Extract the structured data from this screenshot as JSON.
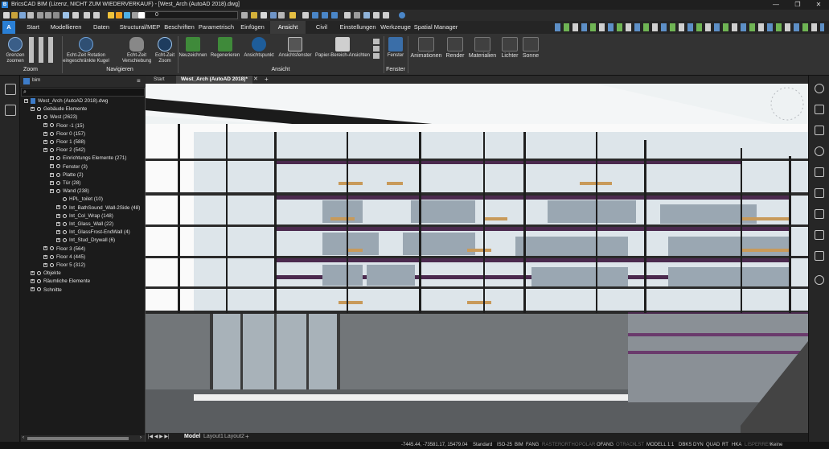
{
  "title_bar": {
    "app_logo": "B",
    "title": "BricsCAD BIM (Lizenz, NICHT ZUM WIEDERVERKAUF) - [West_Arch (AutoAD 2018).dwg]",
    "minimize": "—",
    "maximize": "❐",
    "close": "✕"
  },
  "quick_access": {
    "layer_value": "0"
  },
  "ribbon_tabs": [
    "Start",
    "Modellieren",
    "Daten",
    "Structural/MEP",
    "Beschriften",
    "Parametrisch",
    "Einfügen",
    "Ansicht",
    "Civil",
    "Einstellungen",
    "Werkzeuge",
    "Spatial Manager"
  ],
  "active_tab": "Ansicht",
  "ribbon": {
    "zoom": {
      "label": "Zoom",
      "grenzen": "Grenzen zoomen"
    },
    "navigieren": {
      "label": "Navigieren",
      "orbit": "Echt-Zeit Rotation eingeschränkte Kugel",
      "pan": "Echt-Zeit Verschiebung",
      "zoom_rt": "Echt-Zeit Zoom"
    },
    "ansicht": {
      "label": "Ansicht",
      "redraw": "Neuzeichnen",
      "regen": "Regenerieren",
      "viewpoint": "Ansichtspunkt",
      "viewports": "Ansichtsfenster",
      "paperspace": "Papier-Bereich-Ansichten"
    },
    "fenster": {
      "label": "Fenster",
      "btn": "Fenster"
    },
    "dropdowns": [
      "Animationen",
      "Render",
      "Materialien",
      "Lichter",
      "Sonne"
    ]
  },
  "panel": {
    "header": "bim",
    "search_icon": "search-icon"
  },
  "tree": [
    {
      "indent": 0,
      "kind": "file",
      "text": "West_Arch (AutoAD 2018).dwg"
    },
    {
      "indent": 1,
      "kind": "node",
      "text": "Gebäude Elemente"
    },
    {
      "indent": 2,
      "kind": "node",
      "text": "West (2623)"
    },
    {
      "indent": 3,
      "kind": "node",
      "text": "Floor -1 (15)"
    },
    {
      "indent": 3,
      "kind": "node",
      "text": "Floor 0 (157)"
    },
    {
      "indent": 3,
      "kind": "node",
      "text": "Floor 1 (588)"
    },
    {
      "indent": 3,
      "kind": "node",
      "text": "Floor 2 (542)"
    },
    {
      "indent": 4,
      "kind": "node",
      "text": "Einrichtungs Elemente (271)"
    },
    {
      "indent": 4,
      "kind": "node",
      "text": "Fenster (3)"
    },
    {
      "indent": 4,
      "kind": "node",
      "text": "Platte (2)"
    },
    {
      "indent": 4,
      "kind": "node",
      "text": "Tür (28)"
    },
    {
      "indent": 4,
      "kind": "node",
      "text": "Wand (238)"
    },
    {
      "indent": 5,
      "kind": "leaf",
      "text": "HPL_toilet (10)"
    },
    {
      "indent": 5,
      "kind": "node",
      "text": "Int_BathSound_Wall-2Side (48)"
    },
    {
      "indent": 5,
      "kind": "node",
      "text": "Int_Col_Wrap (148)"
    },
    {
      "indent": 5,
      "kind": "node",
      "text": "Int_Glass_Wall (22)"
    },
    {
      "indent": 5,
      "kind": "node",
      "text": "Int_GlassFrost-EndWall (4)"
    },
    {
      "indent": 5,
      "kind": "node",
      "text": "Int_Stud_Drywall (6)"
    },
    {
      "indent": 3,
      "kind": "node",
      "text": "Floor 3 (564)"
    },
    {
      "indent": 3,
      "kind": "node",
      "text": "Floor 4 (445)"
    },
    {
      "indent": 3,
      "kind": "node",
      "text": "Floor 5 (312)"
    },
    {
      "indent": 1,
      "kind": "node",
      "text": "Objekte"
    },
    {
      "indent": 1,
      "kind": "node",
      "text": "Räumliche Elemente"
    },
    {
      "indent": 1,
      "kind": "node",
      "text": "Schnitte"
    }
  ],
  "doc_tabs": {
    "start": "Start",
    "active": "West_Arch (AutoAD 2018)*",
    "close": "✕",
    "add": "+"
  },
  "layout_tabs": [
    "Model",
    "Layout1",
    "Layout2"
  ],
  "layout_add": "+",
  "status": {
    "coords": "-7445.44, -73581.17, 15479.04",
    "items": [
      {
        "t": "Standard",
        "on": true
      },
      {
        "t": "ISO-25",
        "on": true
      },
      {
        "t": "BIM",
        "on": true
      },
      {
        "t": "FANG",
        "on": true
      },
      {
        "t": "RASTER",
        "on": false
      },
      {
        "t": "ORTHO",
        "on": false
      },
      {
        "t": "POLAR",
        "on": false
      },
      {
        "t": "OFANG",
        "on": true
      },
      {
        "t": "OTRACK",
        "on": false
      },
      {
        "t": "LST",
        "on": false
      },
      {
        "t": "MODELL",
        "on": true
      },
      {
        "t": "1:1",
        "on": true
      },
      {
        "t": "DBKS",
        "on": true
      },
      {
        "t": "DYN",
        "on": true
      },
      {
        "t": "QUAD",
        "on": true
      },
      {
        "t": "RT",
        "on": true
      },
      {
        "t": "HKA",
        "on": true
      },
      {
        "t": "LISPERREN",
        "on": false
      },
      {
        "t": "Keine",
        "on": true
      }
    ]
  }
}
